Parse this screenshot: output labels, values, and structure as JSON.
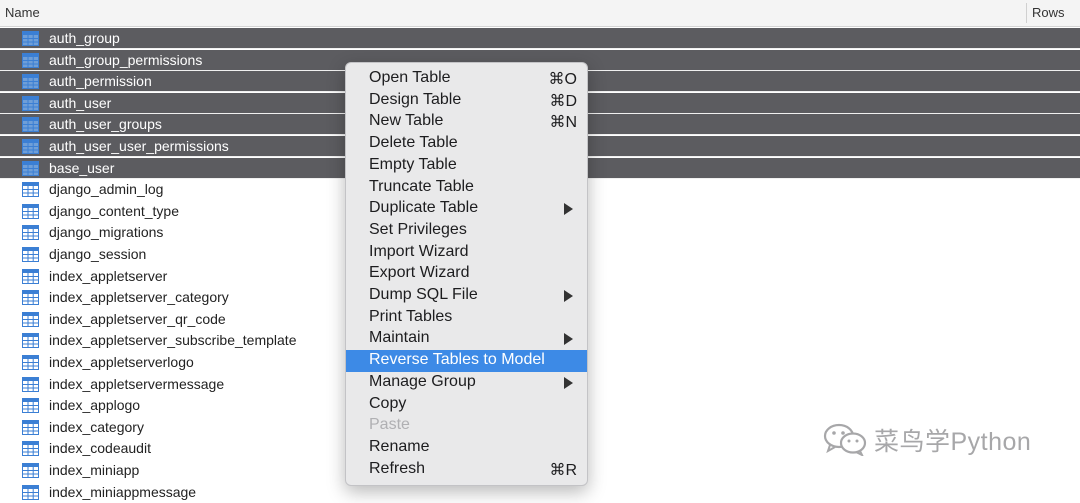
{
  "header": {
    "name_col": "Name",
    "rows_col": "Rows"
  },
  "tables": [
    {
      "name": "auth_group",
      "selected": true
    },
    {
      "name": "auth_group_permissions",
      "selected": true
    },
    {
      "name": "auth_permission",
      "selected": true
    },
    {
      "name": "auth_user",
      "selected": true
    },
    {
      "name": "auth_user_groups",
      "selected": true
    },
    {
      "name": "auth_user_user_permissions",
      "selected": true
    },
    {
      "name": "base_user",
      "selected": true
    },
    {
      "name": "django_admin_log",
      "selected": false
    },
    {
      "name": "django_content_type",
      "selected": false
    },
    {
      "name": "django_migrations",
      "selected": false
    },
    {
      "name": "django_session",
      "selected": false
    },
    {
      "name": "index_appletserver",
      "selected": false
    },
    {
      "name": "index_appletserver_category",
      "selected": false
    },
    {
      "name": "index_appletserver_qr_code",
      "selected": false
    },
    {
      "name": "index_appletserver_subscribe_template",
      "selected": false
    },
    {
      "name": "index_appletserverlogo",
      "selected": false
    },
    {
      "name": "index_appletservermessage",
      "selected": false
    },
    {
      "name": "index_applogo",
      "selected": false
    },
    {
      "name": "index_category",
      "selected": false
    },
    {
      "name": "index_codeaudit",
      "selected": false
    },
    {
      "name": "index_miniapp",
      "selected": false
    },
    {
      "name": "index_miniappmessage",
      "selected": false
    }
  ],
  "context_menu": {
    "items": [
      {
        "label": "Open Table",
        "shortcut": "⌘O"
      },
      {
        "label": "Design Table",
        "shortcut": "⌘D"
      },
      {
        "label": "New Table",
        "shortcut": "⌘N"
      },
      {
        "label": "Delete Table",
        "shortcut": ""
      },
      {
        "label": "Empty Table",
        "shortcut": ""
      },
      {
        "label": "Truncate Table",
        "shortcut": ""
      },
      {
        "label": "Duplicate Table",
        "shortcut": "",
        "submenu": true
      },
      {
        "label": "Set Privileges",
        "shortcut": ""
      },
      {
        "label": "Import Wizard",
        "shortcut": ""
      },
      {
        "label": "Export Wizard",
        "shortcut": ""
      },
      {
        "label": "Dump SQL File",
        "shortcut": "",
        "submenu": true
      },
      {
        "label": "Print Tables",
        "shortcut": ""
      },
      {
        "label": "Maintain",
        "shortcut": "",
        "submenu": true
      },
      {
        "label": "Reverse Tables to Model",
        "shortcut": "",
        "highlighted": true
      },
      {
        "label": "Manage Group",
        "shortcut": "",
        "submenu": true
      },
      {
        "label": "Copy",
        "shortcut": ""
      },
      {
        "label": "Paste",
        "shortcut": "",
        "disabled": true
      },
      {
        "label": "Rename",
        "shortcut": ""
      },
      {
        "label": "Refresh",
        "shortcut": "⌘R"
      }
    ]
  },
  "watermark": {
    "text": "菜鸟学Python",
    "icon": "wechat-icon"
  },
  "colors": {
    "selection": "#5c5c60",
    "menu_highlight": "#3d8ae6",
    "menu_bg": "#e9e9ea",
    "table_icon": "#3b7fd4"
  }
}
